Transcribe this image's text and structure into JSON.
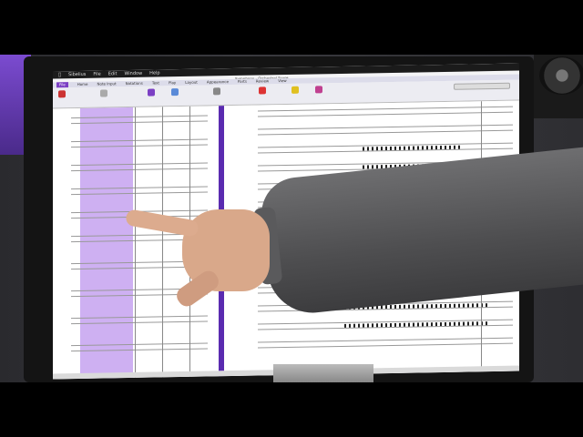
{
  "menu": {
    "app_name": "Sibelius",
    "items": [
      "File",
      "Edit",
      "Window",
      "Help"
    ]
  },
  "window": {
    "title": "Symphony - Orchestral Score"
  },
  "ribbon": {
    "tabs": [
      "File",
      "Home",
      "Note Input",
      "Notations",
      "Text",
      "Play",
      "Layout",
      "Appearance",
      "Parts",
      "Review",
      "View"
    ],
    "active_tab": "Home"
  },
  "colors": {
    "selection": "#c6a2f0",
    "playback_line": "#5a2bb0",
    "active_tab": "#7b3fc4"
  }
}
